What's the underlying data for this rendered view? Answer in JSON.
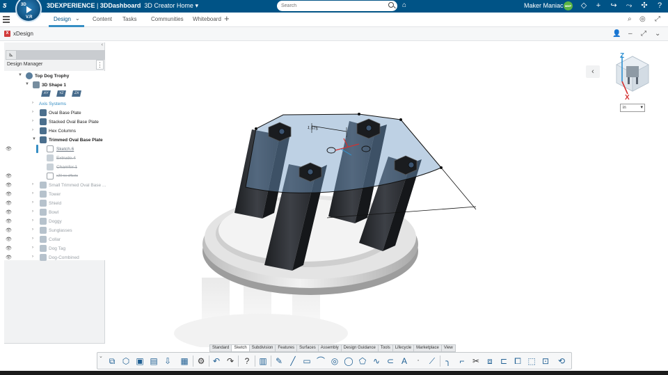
{
  "topbar": {
    "brand": "3DEXPERIENCE",
    "separator": " | ",
    "dashboard": "3DDashboard",
    "home": "3D Creator Home",
    "search_placeholder": "Search",
    "user_name": "Maker Maniac",
    "avatar_initials": "MMP",
    "compass_version": "V.R",
    "compass_q": "3D"
  },
  "tabs": [
    {
      "label": "Design"
    },
    {
      "label": "Content"
    },
    {
      "label": "Tasks"
    },
    {
      "label": "Communities"
    },
    {
      "label": "Whiteboard"
    }
  ],
  "app": {
    "title": "xDesign",
    "icon_letter": "X"
  },
  "panel": {
    "title": "Design Manager",
    "tree": {
      "root": "Top Dog Trophy",
      "shape": "3D Shape 1",
      "planes": [
        "XY",
        "YZ",
        "ZX"
      ],
      "axis": "Axis Systems",
      "items": [
        "Oval Base Plate",
        "Stacked Oval Base Plate",
        "Hex Columns",
        "Trimmed Oval Base Plate"
      ],
      "children": [
        "Sketch.6",
        "Extrude.4",
        "Chamfer.1",
        "x20 no offsets"
      ],
      "dim_items": [
        "Small Trimmed Oval Base ...",
        "Tower",
        "Shield",
        "Bowl",
        "Doggy",
        "Sunglasses",
        "Collar",
        "Dog Tag",
        "Dog-Combined"
      ]
    }
  },
  "viewport": {
    "dimension": "1.575",
    "unit": "in",
    "axis_z": "Z",
    "axis_x": "X"
  },
  "ribbon": {
    "tabs": [
      "Standard",
      "Sketch",
      "Subdivision",
      "Features",
      "Surfaces",
      "Assembly",
      "Design Guidance",
      "Tools",
      "Lifecycle",
      "Marketplace",
      "View"
    ],
    "active": "Sketch"
  },
  "colors": {
    "topbar": "#005386",
    "accent": "#368ec4",
    "avatar": "#5bb544",
    "sketch_plane": "#6f98c4",
    "column": "#2b2d31"
  }
}
